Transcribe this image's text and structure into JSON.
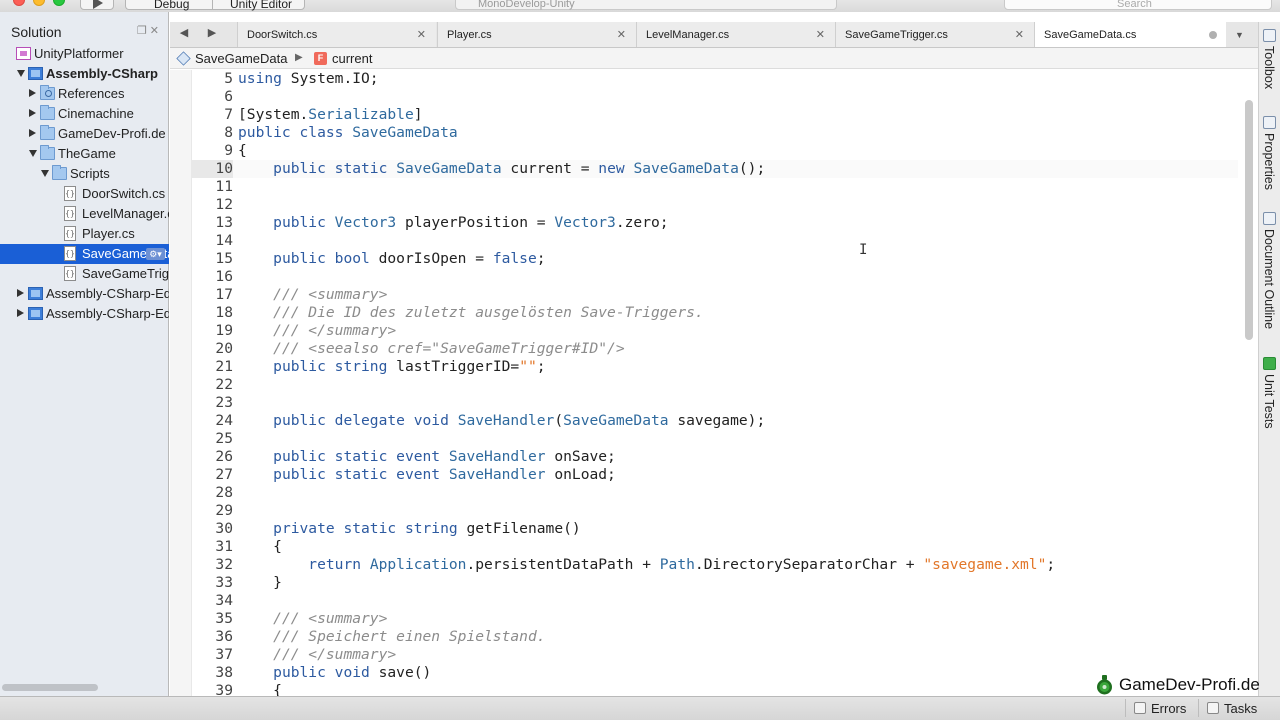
{
  "toolbar": {
    "configuration": "Debug",
    "target": "Unity Editor",
    "status": "MonoDevelop-Unity",
    "search_placeholder": "Search"
  },
  "solution_pad": {
    "title": "Solution",
    "tree": [
      {
        "label": "UnityPlatformer",
        "icon": "solution-icon",
        "depth": 0,
        "expander": "none",
        "bold": false
      },
      {
        "label": "Assembly-CSharp",
        "icon": "project-icon",
        "depth": 1,
        "expander": "expanded",
        "bold": true
      },
      {
        "label": "References",
        "icon": "references-folder-icon",
        "depth": 2,
        "expander": "collapsed",
        "bold": false
      },
      {
        "label": "Cinemachine",
        "icon": "folder-icon",
        "depth": 2,
        "expander": "collapsed",
        "bold": false
      },
      {
        "label": "GameDev-Profi.de",
        "icon": "folder-icon",
        "depth": 2,
        "expander": "collapsed",
        "bold": false
      },
      {
        "label": "TheGame",
        "icon": "folder-icon",
        "depth": 2,
        "expander": "expanded",
        "bold": false
      },
      {
        "label": "Scripts",
        "icon": "folder-icon",
        "depth": 3,
        "expander": "expanded",
        "bold": false
      },
      {
        "label": "DoorSwitch.cs",
        "icon": "csharp-file-icon",
        "depth": 4,
        "expander": "none",
        "bold": false
      },
      {
        "label": "LevelManager.cs",
        "icon": "csharp-file-icon",
        "depth": 4,
        "expander": "none",
        "bold": false
      },
      {
        "label": "Player.cs",
        "icon": "csharp-file-icon",
        "depth": 4,
        "expander": "none",
        "bold": false
      },
      {
        "label": "SaveGameData.cs",
        "icon": "csharp-file-icon",
        "depth": 4,
        "expander": "none",
        "bold": false,
        "selected": true
      },
      {
        "label": "SaveGameTrigger.cs",
        "icon": "csharp-file-icon",
        "depth": 4,
        "expander": "none",
        "bold": false
      },
      {
        "label": "Assembly-CSharp-Editor",
        "icon": "project-icon",
        "depth": 1,
        "expander": "collapsed",
        "bold": false
      },
      {
        "label": "Assembly-CSharp-Editor-firstpass",
        "icon": "project-icon",
        "depth": 1,
        "expander": "collapsed",
        "bold": false
      }
    ]
  },
  "tabs": [
    {
      "label": "DoorSwitch.cs",
      "active": false
    },
    {
      "label": "Player.cs",
      "active": false
    },
    {
      "label": "LevelManager.cs",
      "active": false
    },
    {
      "label": "SaveGameTrigger.cs",
      "active": false
    },
    {
      "label": "SaveGameData.cs",
      "active": true
    }
  ],
  "breadcrumb": {
    "class_name": "SaveGameData",
    "field_badge": "F",
    "member_name": "current"
  },
  "editor": {
    "current_line": 10,
    "lines": [
      {
        "n": 5,
        "t": [
          [
            "kw",
            "using"
          ],
          [
            "p",
            " System.IO;"
          ]
        ]
      },
      {
        "n": 6,
        "t": []
      },
      {
        "n": 7,
        "t": [
          [
            "p",
            "[System."
          ],
          [
            "ty",
            "Serializable"
          ],
          [
            "p",
            "]"
          ]
        ]
      },
      {
        "n": 8,
        "t": [
          [
            "kw",
            "public class"
          ],
          [
            "p",
            " "
          ],
          [
            "ty",
            "SaveGameData"
          ]
        ]
      },
      {
        "n": 9,
        "t": [
          [
            "p",
            "{"
          ]
        ]
      },
      {
        "n": 10,
        "t": [
          [
            "p",
            "    "
          ],
          [
            "kw",
            "public static"
          ],
          [
            "p",
            " "
          ],
          [
            "ty",
            "SaveGameData"
          ],
          [
            "p",
            " current = "
          ],
          [
            "kw",
            "new"
          ],
          [
            "p",
            " "
          ],
          [
            "ty",
            "SaveGameData"
          ],
          [
            "p",
            "();"
          ]
        ]
      },
      {
        "n": 11,
        "t": []
      },
      {
        "n": 12,
        "t": []
      },
      {
        "n": 13,
        "t": [
          [
            "p",
            "    "
          ],
          [
            "kw",
            "public"
          ],
          [
            "p",
            " "
          ],
          [
            "ty",
            "Vector3"
          ],
          [
            "p",
            " playerPosition = "
          ],
          [
            "ty",
            "Vector3"
          ],
          [
            "p",
            ".zero;"
          ]
        ]
      },
      {
        "n": 14,
        "t": []
      },
      {
        "n": 15,
        "t": [
          [
            "p",
            "    "
          ],
          [
            "kw",
            "public bool"
          ],
          [
            "p",
            " doorIsOpen = "
          ],
          [
            "kw",
            "false"
          ],
          [
            "p",
            ";"
          ]
        ]
      },
      {
        "n": 16,
        "t": []
      },
      {
        "n": 17,
        "t": [
          [
            "p",
            "    "
          ],
          [
            "cmt",
            "/// <summary>"
          ]
        ]
      },
      {
        "n": 18,
        "t": [
          [
            "p",
            "    "
          ],
          [
            "cmt",
            "/// Die ID des zuletzt ausgelösten Save-Triggers."
          ]
        ]
      },
      {
        "n": 19,
        "t": [
          [
            "p",
            "    "
          ],
          [
            "cmt",
            "/// </summary>"
          ]
        ]
      },
      {
        "n": 20,
        "t": [
          [
            "p",
            "    "
          ],
          [
            "cmt",
            "/// <seealso cref=\"SaveGameTrigger#ID\"/>"
          ]
        ]
      },
      {
        "n": 21,
        "t": [
          [
            "p",
            "    "
          ],
          [
            "kw",
            "public string"
          ],
          [
            "p",
            " lastTriggerID="
          ],
          [
            "str",
            "\"\""
          ],
          [
            "p",
            ";"
          ]
        ]
      },
      {
        "n": 22,
        "t": []
      },
      {
        "n": 23,
        "t": []
      },
      {
        "n": 24,
        "t": [
          [
            "p",
            "    "
          ],
          [
            "kw",
            "public delegate void"
          ],
          [
            "p",
            " "
          ],
          [
            "ty",
            "SaveHandler"
          ],
          [
            "p",
            "("
          ],
          [
            "ty",
            "SaveGameData"
          ],
          [
            "p",
            " savegame);"
          ]
        ]
      },
      {
        "n": 25,
        "t": []
      },
      {
        "n": 26,
        "t": [
          [
            "p",
            "    "
          ],
          [
            "kw",
            "public static event"
          ],
          [
            "p",
            " "
          ],
          [
            "ty",
            "SaveHandler"
          ],
          [
            "p",
            " onSave;"
          ]
        ]
      },
      {
        "n": 27,
        "t": [
          [
            "p",
            "    "
          ],
          [
            "kw",
            "public static event"
          ],
          [
            "p",
            " "
          ],
          [
            "ty",
            "SaveHandler"
          ],
          [
            "p",
            " onLoad;"
          ]
        ]
      },
      {
        "n": 28,
        "t": []
      },
      {
        "n": 29,
        "t": []
      },
      {
        "n": 30,
        "t": [
          [
            "p",
            "    "
          ],
          [
            "kw",
            "private static string"
          ],
          [
            "p",
            " getFilename()"
          ]
        ]
      },
      {
        "n": 31,
        "t": [
          [
            "p",
            "    {"
          ]
        ]
      },
      {
        "n": 32,
        "t": [
          [
            "p",
            "        "
          ],
          [
            "kw",
            "return"
          ],
          [
            "p",
            " "
          ],
          [
            "ty",
            "Application"
          ],
          [
            "p",
            ".persistentDataPath + "
          ],
          [
            "ty",
            "Path"
          ],
          [
            "p",
            ".DirectorySeparatorChar + "
          ],
          [
            "str",
            "\"savegame.xml\""
          ],
          [
            "p",
            ";"
          ]
        ]
      },
      {
        "n": 33,
        "t": [
          [
            "p",
            "    }"
          ]
        ]
      },
      {
        "n": 34,
        "t": []
      },
      {
        "n": 35,
        "t": [
          [
            "p",
            "    "
          ],
          [
            "cmt",
            "/// <summary>"
          ]
        ]
      },
      {
        "n": 36,
        "t": [
          [
            "p",
            "    "
          ],
          [
            "cmt",
            "/// Speichert einen Spielstand."
          ]
        ]
      },
      {
        "n": 37,
        "t": [
          [
            "p",
            "    "
          ],
          [
            "cmt",
            "/// </summary>"
          ]
        ]
      },
      {
        "n": 38,
        "t": [
          [
            "p",
            "    "
          ],
          [
            "kw",
            "public void"
          ],
          [
            "p",
            " save()"
          ]
        ]
      },
      {
        "n": 39,
        "t": [
          [
            "p",
            "    {"
          ]
        ]
      }
    ]
  },
  "right_dock": [
    {
      "label": "Toolbox",
      "icon": "toolbox-icon"
    },
    {
      "label": "Properties",
      "icon": "properties-icon"
    },
    {
      "label": "Document Outline",
      "icon": "document-outline-icon"
    },
    {
      "label": "Unit Tests",
      "icon": "unit-tests-icon"
    }
  ],
  "watermark": {
    "text": "GameDev-Profi.de"
  },
  "status_bar": {
    "errors_label": "Errors",
    "tasks_label": "Tasks"
  }
}
